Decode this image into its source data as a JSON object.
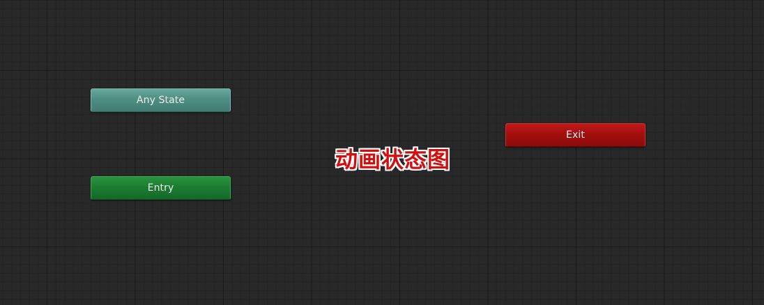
{
  "graph": {
    "nodes": {
      "any_state": {
        "label": "Any State",
        "color": "#4e8e83"
      },
      "entry": {
        "label": "Entry",
        "color": "#1b7c31"
      },
      "exit": {
        "label": "Exit",
        "color": "#a30f0f"
      }
    },
    "overlay_title": "动画状态图"
  },
  "colors": {
    "background": "#282828",
    "grid_major": "#1a1a1a",
    "grid_minor": "#232323",
    "overlay_text": "#d10f0f",
    "overlay_outline": "#ffffff"
  }
}
